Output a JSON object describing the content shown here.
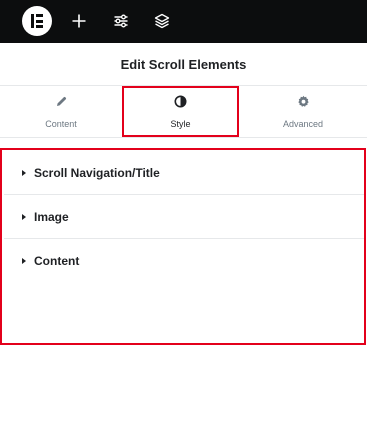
{
  "topbar": {
    "logo_icon": "elementor-logo-icon",
    "add_icon": "plus-icon",
    "settings_icon": "sliders-icon",
    "structure_icon": "layers-icon",
    "background": "#0c0d0e"
  },
  "header": {
    "title": "Edit Scroll Elements"
  },
  "tabs": [
    {
      "label": "Content",
      "icon": "pencil-icon",
      "active": false
    },
    {
      "label": "Style",
      "icon": "contrast-icon",
      "active": true
    },
    {
      "label": "Advanced",
      "icon": "gear-icon",
      "active": false
    }
  ],
  "sections": [
    {
      "label": "Scroll Navigation/Title",
      "icon": "caret-right-icon"
    },
    {
      "label": "Image",
      "icon": "caret-right-icon"
    },
    {
      "label": "Content",
      "icon": "caret-right-icon"
    }
  ],
  "colors": {
    "highlight": "#e3001b",
    "text": "#1f2124",
    "muted": "#6d7882",
    "divider": "#e6e8ea"
  }
}
